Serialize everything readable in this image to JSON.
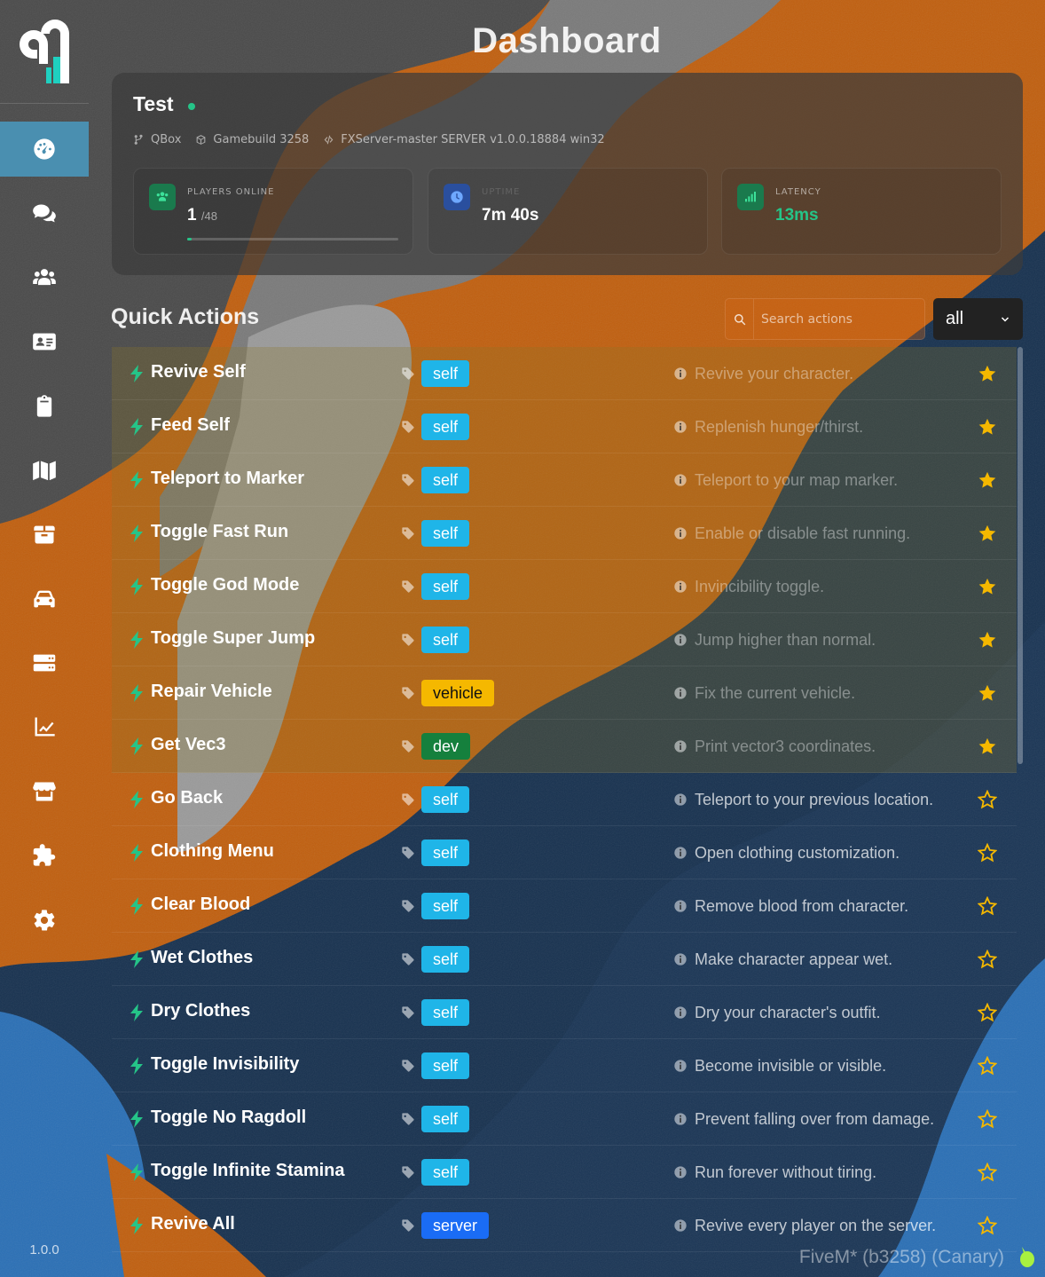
{
  "app": {
    "version": "1.0.0",
    "page_title": "Dashboard",
    "watermark": "FiveM* (b3258) (Canary)"
  },
  "sidebar": {
    "items": [
      {
        "name": "dashboard",
        "icon": "gauge-icon",
        "active": true
      },
      {
        "name": "chat",
        "icon": "chat-bubbles-icon",
        "active": false
      },
      {
        "name": "players",
        "icon": "users-icon",
        "active": false
      },
      {
        "name": "identity",
        "icon": "id-card-icon",
        "active": false
      },
      {
        "name": "reports",
        "icon": "clipboard-icon",
        "active": false
      },
      {
        "name": "map",
        "icon": "map-icon",
        "active": false
      },
      {
        "name": "items",
        "icon": "box-icon",
        "active": false
      },
      {
        "name": "vehicles",
        "icon": "car-icon",
        "active": false
      },
      {
        "name": "server",
        "icon": "server-icon",
        "active": false
      },
      {
        "name": "stats",
        "icon": "chart-line-icon",
        "active": false
      },
      {
        "name": "store",
        "icon": "store-icon",
        "active": false
      },
      {
        "name": "resources",
        "icon": "puzzle-icon",
        "active": false
      },
      {
        "name": "settings",
        "icon": "gear-icon",
        "active": false
      }
    ]
  },
  "server": {
    "name": "Test",
    "framework": "QBox",
    "gamebuild": "Gamebuild 3258",
    "version": "FXServer-master SERVER v1.0.0.18884 win32",
    "stats": {
      "players": {
        "label": "PLAYERS ONLINE",
        "value": "1",
        "max": "/48",
        "progress": 0.02
      },
      "uptime": {
        "label": "UPTIME",
        "value": "7m 40s"
      },
      "latency": {
        "label": "LATENCY",
        "value": "13ms"
      }
    },
    "colors": {
      "online": "#25c488",
      "latency": "#25c488"
    }
  },
  "quick_actions": {
    "title": "Quick Actions",
    "search_placeholder": "Search actions",
    "filter_value": "all",
    "items": [
      {
        "name": "Revive Self",
        "tag": "self",
        "description": "Revive your character.",
        "favorite": true
      },
      {
        "name": "Feed Self",
        "tag": "self",
        "description": "Replenish hunger/thirst.",
        "favorite": true
      },
      {
        "name": "Teleport to Marker",
        "tag": "self",
        "description": "Teleport to your map marker.",
        "favorite": true
      },
      {
        "name": "Toggle Fast Run",
        "tag": "self",
        "description": "Enable or disable fast running.",
        "favorite": true
      },
      {
        "name": "Toggle God Mode",
        "tag": "self",
        "description": "Invincibility toggle.",
        "favorite": true
      },
      {
        "name": "Toggle Super Jump",
        "tag": "self",
        "description": "Jump higher than normal.",
        "favorite": true
      },
      {
        "name": "Repair Vehicle",
        "tag": "vehicle",
        "description": "Fix the current vehicle.",
        "favorite": true
      },
      {
        "name": "Get Vec3",
        "tag": "dev",
        "description": "Print vector3 coordinates.",
        "favorite": true
      },
      {
        "name": "Go Back",
        "tag": "self",
        "description": "Teleport to your previous location.",
        "favorite": false
      },
      {
        "name": "Clothing Menu",
        "tag": "self",
        "description": "Open clothing customization.",
        "favorite": false
      },
      {
        "name": "Clear Blood",
        "tag": "self",
        "description": "Remove blood from character.",
        "favorite": false
      },
      {
        "name": "Wet Clothes",
        "tag": "self",
        "description": "Make character appear wet.",
        "favorite": false
      },
      {
        "name": "Dry Clothes",
        "tag": "self",
        "description": "Dry your character's outfit.",
        "favorite": false
      },
      {
        "name": "Toggle Invisibility",
        "tag": "self",
        "description": "Become invisible or visible.",
        "favorite": false
      },
      {
        "name": "Toggle No Ragdoll",
        "tag": "self",
        "description": "Prevent falling over from damage.",
        "favorite": false
      },
      {
        "name": "Toggle Infinite Stamina",
        "tag": "self",
        "description": "Run forever without tiring.",
        "favorite": false
      },
      {
        "name": "Revive All",
        "tag": "server",
        "description": "Revive every player on the server.",
        "favorite": false
      }
    ],
    "tag_colors": {
      "self": "#1fb5e8",
      "vehicle": "#f5b800",
      "dev": "#15803d",
      "server": "#1a6cf5"
    },
    "accent": "#25c488",
    "star_color": "#f5b800"
  }
}
